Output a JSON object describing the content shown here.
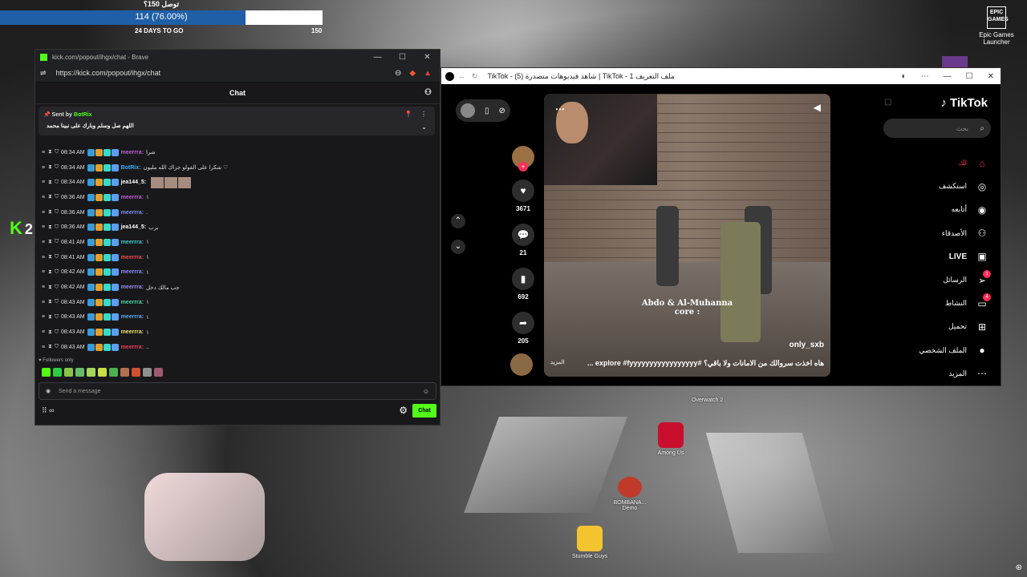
{
  "goal": {
    "title": "توصل 150؟",
    "value_text": "114 (76.00%)",
    "progress_fraction": 0.76,
    "days_left": "24 DAYS TO GO",
    "target": "150"
  },
  "kick_side": {
    "logo": "K",
    "count": "2"
  },
  "brave": {
    "window_title": "kick.com/popout/ihgx/chat - Brave",
    "url": "https://kick.com/popout/ihgx/chat",
    "controls": {
      "minimize": "—",
      "maximize": "☐",
      "close": "✕"
    }
  },
  "chat": {
    "header": "Chat",
    "pinned": {
      "sent_by_label": "Sent by",
      "sender": "BotRix",
      "message": "اللهم صل وسلم وبارك على نبينا محمد"
    },
    "messages": [
      {
        "time": "08:34 AM",
        "user": "meerrra:",
        "text": "شرا",
        "color": "#c05ed7",
        "emotes": 0
      },
      {
        "time": "08:34 AM",
        "user": "BotRix:",
        "text": "شكرا على الفولو جزاك الله مليون ♡",
        "color": "#3fa9f5",
        "emotes": 0
      },
      {
        "time": "08:34 AM",
        "user": "jea144_5:",
        "text": "",
        "color": "#ffffff",
        "emotes": 3
      },
      {
        "time": "08:36 AM",
        "user": "meerrra:",
        "text": "١",
        "color": "#c05ed7",
        "emotes": 0
      },
      {
        "time": "08:36 AM",
        "user": "meerrra:",
        "text": ".",
        "color": "#7b8cf5",
        "emotes": 0
      },
      {
        "time": "08:36 AM",
        "user": "jea144_5:",
        "text": "برب",
        "color": "#ffffff",
        "emotes": 0
      },
      {
        "time": "08:41 AM",
        "user": "meerrra:",
        "text": "١",
        "color": "#3ac7c7",
        "emotes": 0
      },
      {
        "time": "08:41 AM",
        "user": "meerrra:",
        "text": "١",
        "color": "#f04a4a",
        "emotes": 0
      },
      {
        "time": "08:42 AM",
        "user": "meerrra:",
        "text": "١",
        "color": "#8f8df5",
        "emotes": 0
      },
      {
        "time": "08:42 AM",
        "user": "meerrra:",
        "text": "جب مالك دخل",
        "color": "#9a8df0",
        "emotes": 0
      },
      {
        "time": "08:43 AM",
        "user": "meerrra:",
        "text": "١",
        "color": "#4ad6a0",
        "emotes": 0
      },
      {
        "time": "08:43 AM",
        "user": "meerrra:",
        "text": "١",
        "color": "#5aa8f0",
        "emotes": 0
      },
      {
        "time": "08:43 AM",
        "user": "meerrra:",
        "text": "١",
        "color": "#e6e06a",
        "emotes": 0
      },
      {
        "time": "08:43 AM",
        "user": "meerrra:",
        "text": "..",
        "color": "#ef3a5d",
        "emotes": 0
      }
    ],
    "followers_only": "Followers only",
    "input_placeholder": "Send a message",
    "bottom_label": "∞",
    "send_button": "Chat"
  },
  "tiktok": {
    "tab_title": "TikTok - (5) شاهد فيديوهات متصدرة | TikTok - ملف التعريف 1",
    "logo": "TikTok",
    "search_placeholder": "بحث",
    "video": {
      "caption_line1": "Abdo & Al-Muhanna",
      "caption_line2": "core :",
      "author": "only_sxb",
      "description": "هاه اخذت سروالك من الامانات ولا باقي؟ #explore #fyyyyyyyyyyyyyyyyy ...",
      "more": "المزيد"
    },
    "actions": {
      "likes": "3671",
      "comments": "21",
      "saves": "692",
      "shares": "205"
    },
    "nav": [
      {
        "label": "لك",
        "icon": "home-icon",
        "badge": ""
      },
      {
        "label": "استكشف",
        "icon": "compass-icon",
        "badge": ""
      },
      {
        "label": "أتابعه",
        "icon": "following-avatar-icon",
        "badge": ""
      },
      {
        "label": "الأصدقاء",
        "icon": "friends-icon",
        "badge": ""
      },
      {
        "label": "LIVE",
        "icon": "live-icon",
        "badge": ""
      },
      {
        "label": "الرسائل",
        "icon": "messages-icon",
        "badge": "1"
      },
      {
        "label": "النشاط",
        "icon": "activity-icon",
        "badge": "4"
      },
      {
        "label": "تحميل",
        "icon": "upload-icon",
        "badge": ""
      },
      {
        "label": "الملف الشخصي",
        "icon": "profile-avatar-icon",
        "badge": ""
      },
      {
        "label": "المزيد",
        "icon": "more-icon",
        "badge": ""
      }
    ]
  },
  "desktop": {
    "epic_logo": "EPIC GAMES",
    "epic_label": "Epic Games Launcher",
    "overwatch_label": "Overwatch 2",
    "among_us": "Among Us",
    "bombana": "BOMBANA... Demo",
    "stumble": "Stumble Guys"
  },
  "colors": {
    "kick_green": "#53fc18",
    "tiktok_red": "#fe2c55",
    "goal_blue": "#1f5fa8"
  }
}
